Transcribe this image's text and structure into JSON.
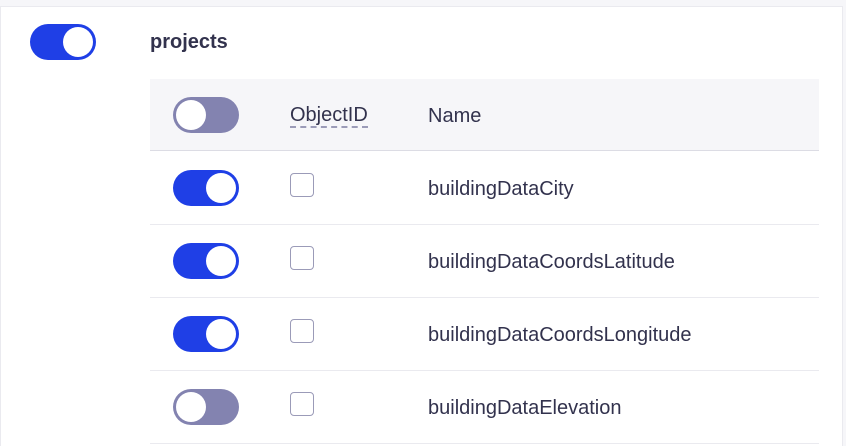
{
  "section": {
    "title": "projects",
    "enabled": true
  },
  "table": {
    "header": {
      "select_all_enabled": false,
      "col_objectid": "ObjectID",
      "col_name": "Name"
    },
    "rows": [
      {
        "name": "buildingDataCity",
        "enabled": true,
        "checked": false
      },
      {
        "name": "buildingDataCoordsLatitude",
        "enabled": true,
        "checked": false
      },
      {
        "name": "buildingDataCoordsLongitude",
        "enabled": true,
        "checked": false
      },
      {
        "name": "buildingDataElevation",
        "enabled": false,
        "checked": false
      }
    ]
  },
  "colors": {
    "toggle_on": "#1f3fe6",
    "toggle_off": "#8383b0",
    "text": "#32324d",
    "header_bg": "#f6f6f9"
  }
}
